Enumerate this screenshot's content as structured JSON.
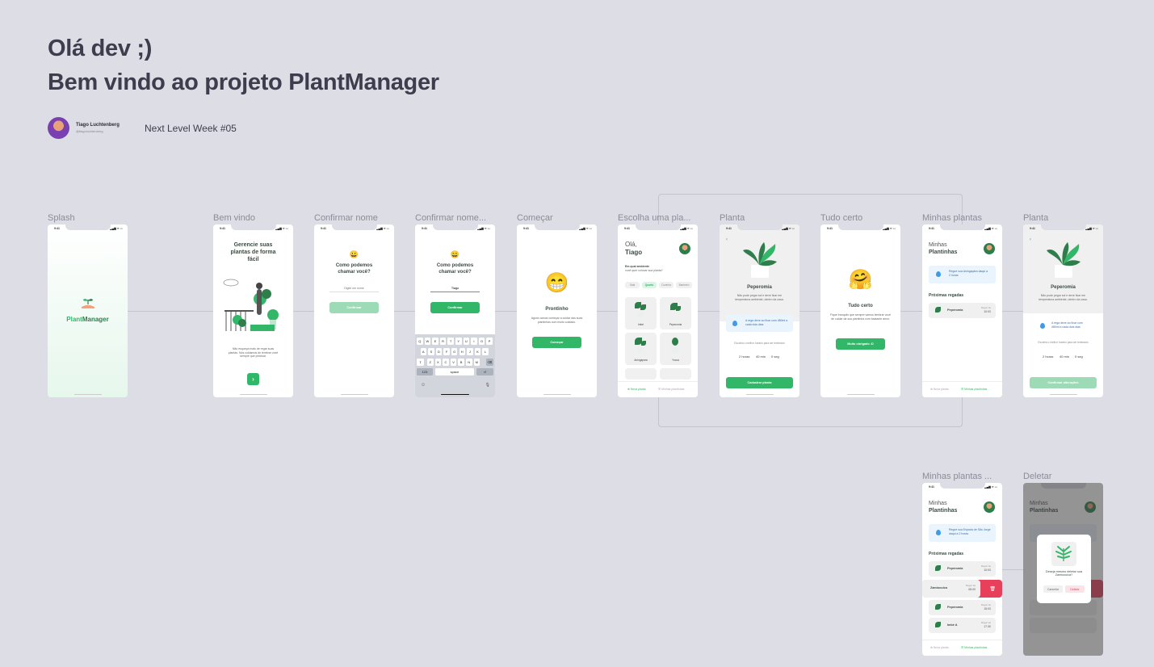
{
  "header": {
    "line1": "Olá dev ;)",
    "line2": "Bem vindo ao projeto PlantManager"
  },
  "author": {
    "name": "Tiago Luchtenberg",
    "handle": "@tiagoluchtenberg"
  },
  "event": "Next Level Week #05",
  "status_time": "9:41",
  "status_icons": "▂▄▆ ≋ ▭",
  "frames": {
    "splash": "Splash",
    "welcome": "Bem vindo",
    "confirm": "Confirmar nome",
    "confirm2": "Confirmar nome...",
    "start": "Começar",
    "choose": "Escolha uma pla...",
    "plant": "Planta",
    "allset": "Tudo certo",
    "myplants": "Minhas plantas",
    "plant2": "Planta",
    "myplants2": "Minhas plantas ...",
    "delete": "Deletar"
  },
  "splash": {
    "brand_a": "Plant",
    "brand_b": "Manager"
  },
  "welcome": {
    "title": "Gerencie suas plantas de forma fácil",
    "text": "Não esqueça mais de regar suas plantas. Nós cuidamos de lembrar você sempre que precisar.",
    "button_icon": "›"
  },
  "confirm": {
    "emoji": "😀",
    "title": "Como podemos chamar você?",
    "placeholder": "Digite um nome",
    "button": "Confirmar"
  },
  "confirm2": {
    "emoji": "😄",
    "title": "Como podemos chamar você?",
    "value": "Tiago",
    "button": "Confirmar",
    "kb_row1": [
      "Q",
      "W",
      "E",
      "R",
      "T",
      "Y",
      "U",
      "I",
      "O",
      "P"
    ],
    "kb_row2": [
      "A",
      "S",
      "D",
      "F",
      "G",
      "H",
      "J",
      "K",
      "L"
    ],
    "kb_row3": [
      "Z",
      "X",
      "C",
      "V",
      "B",
      "N",
      "M"
    ],
    "kb_shift": "⇧",
    "kb_del": "⌫",
    "kb_123": "123",
    "kb_space": "space",
    "kb_return": "⏎",
    "kb_emoji": "☺",
    "kb_mic": "🎙"
  },
  "start": {
    "emoji": "😁",
    "title": "Prontinho",
    "text": "Agora vamos começar a cuidar das suas plantinhas com muito cuidado.",
    "button": "Começar"
  },
  "choose": {
    "greeting": "Olá,",
    "name": "Tiago",
    "question_bold": "Em qual ambiente",
    "question": "você quer colocar sua planta?",
    "chips": [
      "Sala",
      "Quarto",
      "Cozinha",
      "Banheiro"
    ],
    "plants": [
      "Imbé",
      "Peperomia",
      "Aningapara",
      "Yucca"
    ],
    "tab_new": "Nova planta",
    "tab_mine": "Minhas plantinhas"
  },
  "plant": {
    "name": "Peperomia",
    "about": "Não pode pegar sol e deve ficar em temperatura ambiente, dentro da casa.",
    "water_tip": "A rega deve ao ficar com 480ml a cada dois dias",
    "reminder": "Escolha o melhor horário para ser lembrado",
    "hours": "2 horas",
    "minutes": "40 min",
    "seconds": "0 seg",
    "button": "Cadastrar planta"
  },
  "allset": {
    "emoji": "🤗",
    "title": "Tudo certo",
    "text": "Fique tranquilo que sempre vamos lembrar você de cuidar da sua plantinha com bastante amor.",
    "button": "Muito obrigado :D"
  },
  "myplants": {
    "title_a": "Minhas",
    "title_b": "Plantinhas",
    "tip": "Regue sua Aningapára daqui a 2 horas",
    "next": "Próximas regadas",
    "items": [
      {
        "name": "Peperomia",
        "label": "Regar às",
        "time": "10:00"
      }
    ],
    "tab_new": "Nova planta",
    "tab_mine": "Minhas plantinhas"
  },
  "plant2": {
    "name": "Peperomia",
    "about": "Não pode pegar sol e deve ficar em temperatura ambiente, dentro da casa.",
    "water_tip": "A rega deve ao ficar com 480ml a cada dois dias",
    "reminder": "Escolha o melhor horário para ser lembrado",
    "hours": "2 horas",
    "minutes": "40 min",
    "seconds": "0 seg",
    "button": "Confirmar alterações"
  },
  "myplants2": {
    "title_a": "Minhas",
    "title_b": "Plantinhas",
    "tip": "Regue sua Espada de São Jorge daqui a 2 horas",
    "next": "Próximas regadas",
    "items": [
      {
        "name": "Peperomia",
        "label": "Regar às",
        "time": "10:00"
      },
      {
        "name": "Zamioculca",
        "label": "Regar às",
        "time": "08:00"
      },
      {
        "name": "Peperomia",
        "label": "Regar às",
        "time": "15:00"
      },
      {
        "name": "Imbé A",
        "label": "Regar às",
        "time": "17:30"
      }
    ],
    "tab_new": "Nova planta",
    "tab_mine": "Minhas plantinhas"
  },
  "delete": {
    "question": "Deseja mesmo deletar sua Zamioculca?",
    "cancel": "Cancelar",
    "confirm": "Deletar"
  },
  "colors": {
    "green": "#32b768",
    "red": "#e83f5b",
    "bg": "#dddde6"
  }
}
